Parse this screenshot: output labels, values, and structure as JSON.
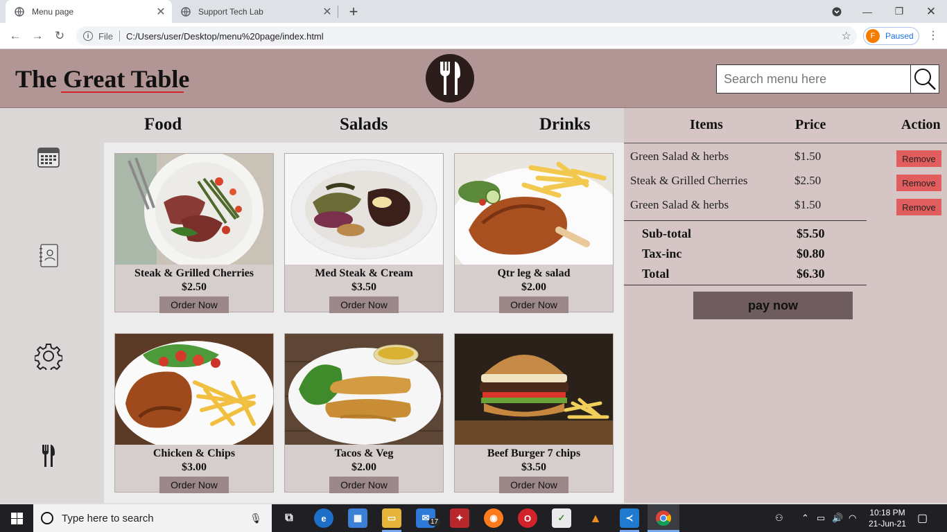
{
  "browser": {
    "tabs": [
      {
        "title": "Menu page",
        "close": "✕"
      },
      {
        "title": "Support Tech Lab",
        "close": "✕"
      }
    ],
    "new_tab": "+",
    "window_controls": {
      "minimize": "—",
      "maximize": "❐",
      "close": "✕"
    },
    "address": {
      "scheme": "File",
      "url": "C:/Users/user/Desktop/menu%20page/index.html"
    },
    "profile": {
      "initial": "F",
      "status": "Paused"
    }
  },
  "site": {
    "title": "The Great Table",
    "search_placeholder": "Search menu here",
    "categories": [
      "Food",
      "Salads",
      "Drinks"
    ],
    "order_label": "Order Now",
    "menu": [
      {
        "name": "Steak & Grilled Cherries",
        "price": "$2.50"
      },
      {
        "name": "Med Steak & Cream",
        "price": "$3.50"
      },
      {
        "name": "Qtr leg & salad",
        "price": "$2.00"
      },
      {
        "name": "Chicken & Chips",
        "price": "$3.00"
      },
      {
        "name": "Tacos & Veg",
        "price": "$2.00"
      },
      {
        "name": "Beef Burger 7 chips",
        "price": "$3.50"
      }
    ],
    "sidebar_icons": [
      "calendar-icon",
      "contacts-icon",
      "settings-gear-icon",
      "cutlery-icon"
    ]
  },
  "cart": {
    "headers": {
      "items": "Items",
      "price": "Price",
      "action": "Action"
    },
    "rows": [
      {
        "item": "Green Salad & herbs",
        "price": "$1.50",
        "action": "Remove"
      },
      {
        "item": "Steak & Grilled Cherries",
        "price": "$2.50",
        "action": "Remove"
      },
      {
        "item": "Green Salad & herbs",
        "price": "$1.50",
        "action": "Remove"
      }
    ],
    "totals": [
      {
        "label": "Sub-total",
        "value": "$5.50"
      },
      {
        "label": "Tax-inc",
        "value": "$0.80"
      },
      {
        "label": "Total",
        "value": "$6.30"
      }
    ],
    "pay_label": "pay now"
  },
  "taskbar": {
    "search_placeholder": "Type here to search",
    "mail_badge": "17",
    "time": "10:18 PM",
    "date": "21-Jun-21"
  },
  "colors": {
    "header_bg": "#b29696",
    "remove_button": "#e25d5d",
    "pay_button": "#6e5c5f",
    "order_button": "#9c8888",
    "title_underline": "#d2232a"
  }
}
